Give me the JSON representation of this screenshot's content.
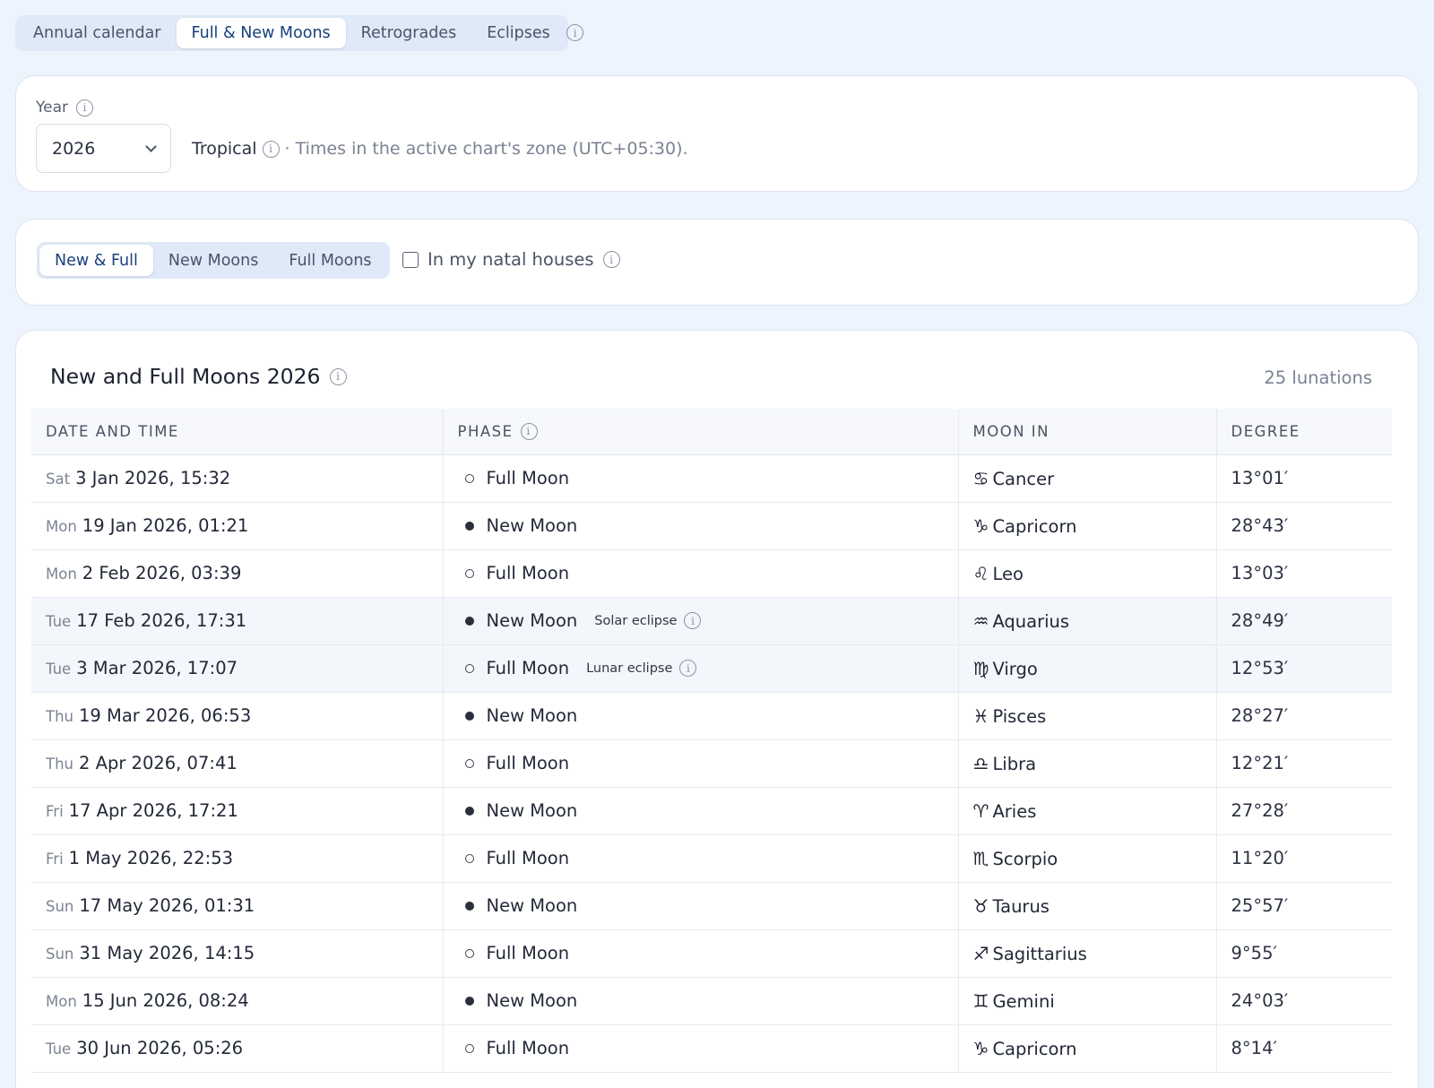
{
  "top_tabs": [
    {
      "label": "Annual calendar",
      "active": false
    },
    {
      "label": "Full & New Moons",
      "active": true
    },
    {
      "label": "Retrogrades",
      "active": false
    },
    {
      "label": "Eclipses",
      "active": false
    }
  ],
  "settings": {
    "year_label": "Year",
    "year_value": "2026",
    "zodiac": "Tropical",
    "timezone_note": "· Times in the active chart's zone (UTC+05:30)."
  },
  "filters": {
    "tabs": [
      {
        "label": "New & Full",
        "active": true
      },
      {
        "label": "New Moons",
        "active": false
      },
      {
        "label": "Full Moons",
        "active": false
      }
    ],
    "natal_label": "In my natal houses",
    "natal_checked": false
  },
  "table": {
    "title": "New and Full Moons 2026",
    "count": "25 lunations",
    "headers": {
      "date": "DATE AND TIME",
      "phase": "PHASE",
      "moon_in": "MOON IN",
      "degree": "DEGREE"
    },
    "rows": [
      {
        "dow": "Sat",
        "date": "3 Jan 2026, 15:32",
        "phase": "Full Moon",
        "kind": "full",
        "eclipse": "",
        "glyph": "♋",
        "sign": "Cancer",
        "degree": "13°01′"
      },
      {
        "dow": "Mon",
        "date": "19 Jan 2026, 01:21",
        "phase": "New Moon",
        "kind": "new",
        "eclipse": "",
        "glyph": "♑",
        "sign": "Capricorn",
        "degree": "28°43′"
      },
      {
        "dow": "Mon",
        "date": "2 Feb 2026, 03:39",
        "phase": "Full Moon",
        "kind": "full",
        "eclipse": "",
        "glyph": "♌",
        "sign": "Leo",
        "degree": "13°03′"
      },
      {
        "dow": "Tue",
        "date": "17 Feb 2026, 17:31",
        "phase": "New Moon",
        "kind": "new",
        "eclipse": "Solar eclipse",
        "glyph": "♒",
        "sign": "Aquarius",
        "degree": "28°49′"
      },
      {
        "dow": "Tue",
        "date": "3 Mar 2026, 17:07",
        "phase": "Full Moon",
        "kind": "full",
        "eclipse": "Lunar eclipse",
        "glyph": "♍",
        "sign": "Virgo",
        "degree": "12°53′"
      },
      {
        "dow": "Thu",
        "date": "19 Mar 2026, 06:53",
        "phase": "New Moon",
        "kind": "new",
        "eclipse": "",
        "glyph": "♓",
        "sign": "Pisces",
        "degree": "28°27′"
      },
      {
        "dow": "Thu",
        "date": "2 Apr 2026, 07:41",
        "phase": "Full Moon",
        "kind": "full",
        "eclipse": "",
        "glyph": "♎",
        "sign": "Libra",
        "degree": "12°21′"
      },
      {
        "dow": "Fri",
        "date": "17 Apr 2026, 17:21",
        "phase": "New Moon",
        "kind": "new",
        "eclipse": "",
        "glyph": "♈",
        "sign": "Aries",
        "degree": "27°28′"
      },
      {
        "dow": "Fri",
        "date": "1 May 2026, 22:53",
        "phase": "Full Moon",
        "kind": "full",
        "eclipse": "",
        "glyph": "♏",
        "sign": "Scorpio",
        "degree": "11°20′"
      },
      {
        "dow": "Sun",
        "date": "17 May 2026, 01:31",
        "phase": "New Moon",
        "kind": "new",
        "eclipse": "",
        "glyph": "♉",
        "sign": "Taurus",
        "degree": "25°57′"
      },
      {
        "dow": "Sun",
        "date": "31 May 2026, 14:15",
        "phase": "Full Moon",
        "kind": "full",
        "eclipse": "",
        "glyph": "♐",
        "sign": "Sagittarius",
        "degree": "9°55′"
      },
      {
        "dow": "Mon",
        "date": "15 Jun 2026, 08:24",
        "phase": "New Moon",
        "kind": "new",
        "eclipse": "",
        "glyph": "♊",
        "sign": "Gemini",
        "degree": "24°03′"
      },
      {
        "dow": "Tue",
        "date": "30 Jun 2026, 05:26",
        "phase": "Full Moon",
        "kind": "full",
        "eclipse": "",
        "glyph": "♑",
        "sign": "Capricorn",
        "degree": "8°14′"
      }
    ]
  }
}
